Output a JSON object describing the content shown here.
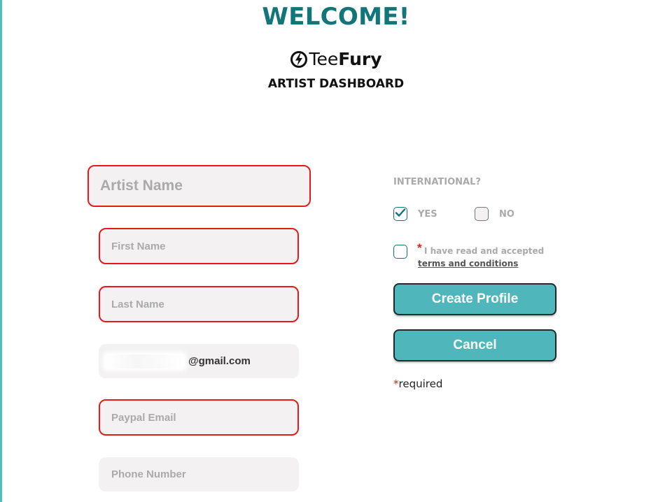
{
  "header": {
    "welcome": "WELCOME!",
    "brand_light": "Tee",
    "brand_bold": "Fury",
    "subtitle": "ARTIST DASHBOARD"
  },
  "form": {
    "artist_name": {
      "placeholder": "Artist Name",
      "error": true
    },
    "first_name": {
      "placeholder": "First Name",
      "error": true
    },
    "last_name": {
      "placeholder": "Last Name",
      "error": true
    },
    "email": {
      "value_suffix": "@gmail.com",
      "redacted_prefix": true
    },
    "paypal_email": {
      "placeholder": "Paypal Email",
      "error": true
    },
    "phone_number": {
      "placeholder": "Phone Number",
      "error": false
    }
  },
  "international": {
    "label": "INTERNATIONAL?",
    "yes_label": "YES",
    "no_label": "NO",
    "yes_checked": true,
    "no_checked": false
  },
  "terms": {
    "star": "*",
    "text": "I have read and accepted",
    "link_text": "terms and conditions",
    "checked": false
  },
  "buttons": {
    "create": "Create Profile",
    "cancel": "Cancel"
  },
  "required_note": {
    "star": "*",
    "text": "required"
  },
  "colors": {
    "accent": "#127579",
    "button": "#4fb6bb",
    "error_border": "#e31b1b",
    "field_bg": "#f3f1f1"
  },
  "icons": {
    "brand": "teefury-bolt-logo-icon",
    "yes_check": "checkmark-icon"
  }
}
